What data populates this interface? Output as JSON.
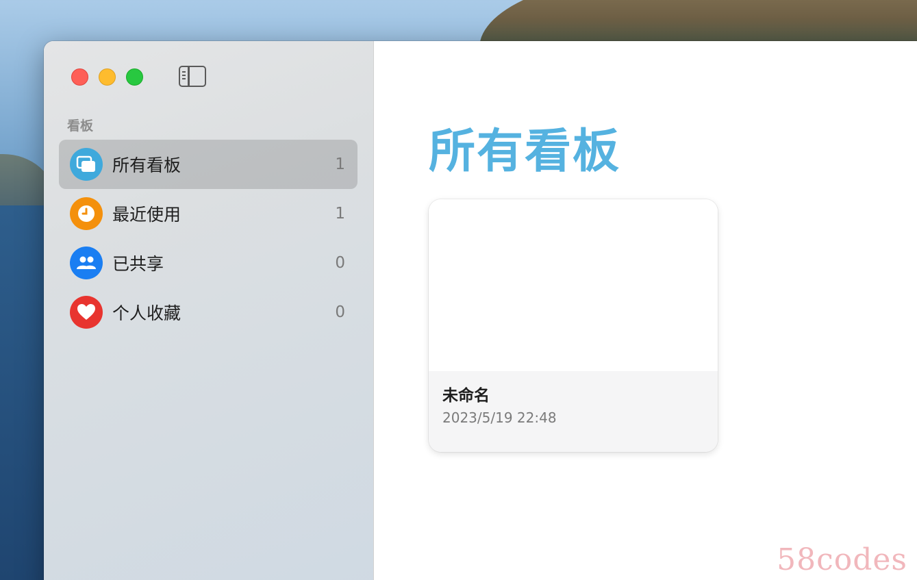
{
  "sidebar": {
    "section_title": "看板",
    "items": [
      {
        "label": "所有看板",
        "count": "1",
        "icon": "stacked-boards-icon",
        "color": "#3fa9dc",
        "selected": true
      },
      {
        "label": "最近使用",
        "count": "1",
        "icon": "clock-icon",
        "color": "#f4900c",
        "selected": false
      },
      {
        "label": "已共享",
        "count": "0",
        "icon": "people-icon",
        "color": "#1a7ef2",
        "selected": false
      },
      {
        "label": "个人收藏",
        "count": "0",
        "icon": "heart-icon",
        "color": "#e8342f",
        "selected": false
      }
    ]
  },
  "main": {
    "title": "所有看板",
    "boards": [
      {
        "title": "未命名",
        "date": "2023/5/19 22:48"
      }
    ]
  },
  "watermark": "58codes",
  "colors": {
    "accent": "#55b2e0",
    "close": "#fe5f57",
    "minimize": "#febc2e",
    "zoom": "#28c840"
  }
}
